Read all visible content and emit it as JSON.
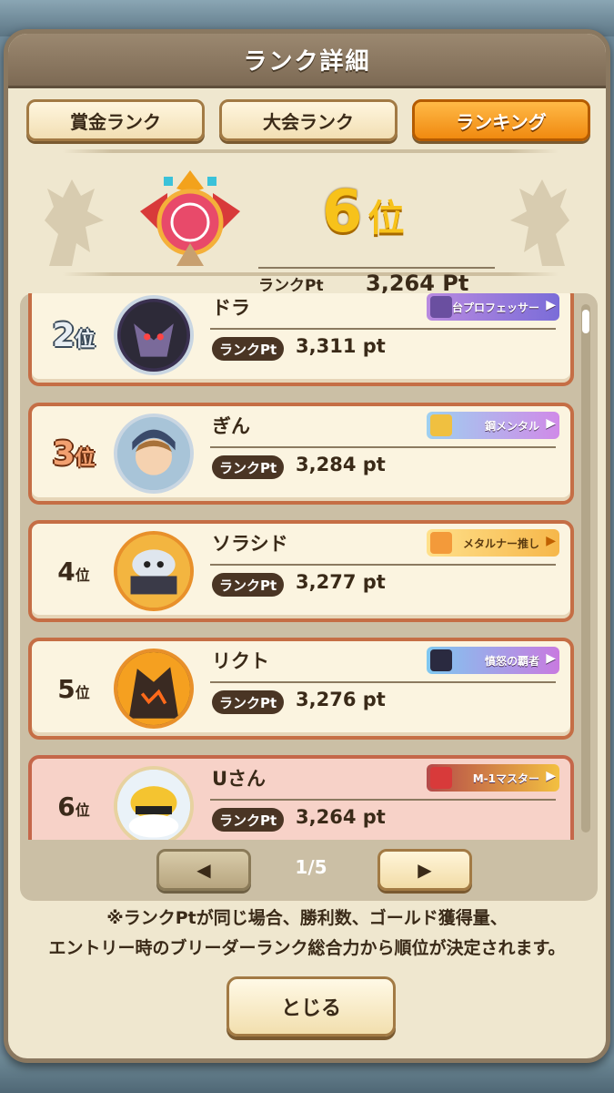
{
  "dialog": {
    "title": "ランク詳細"
  },
  "tabs": [
    {
      "label": "賞金ランク",
      "active": false
    },
    {
      "label": "大会ランク",
      "active": false
    },
    {
      "label": "ランキング",
      "active": true
    }
  ],
  "my_rank": {
    "position": "6",
    "position_suffix": "位",
    "pt_label": "ランクPt",
    "pt_value": "3,264 Pt"
  },
  "ranking_rows": [
    {
      "rank": "2",
      "rank_suffix": "位",
      "name": "ドラ",
      "title": "舞台プロフェッサー",
      "pt_label": "ランクPt",
      "pt": "3,311 pt",
      "self": false
    },
    {
      "rank": "3",
      "rank_suffix": "位",
      "name": "ぎん",
      "title": "鋼メンタル",
      "pt_label": "ランクPt",
      "pt": "3,284 pt",
      "self": false
    },
    {
      "rank": "4",
      "rank_suffix": "位",
      "name": "ソラシド",
      "title": "メタルナー推し",
      "pt_label": "ランクPt",
      "pt": "3,277 pt",
      "self": false
    },
    {
      "rank": "5",
      "rank_suffix": "位",
      "name": "リクト",
      "title": "憤怒の覇者",
      "pt_label": "ランクPt",
      "pt": "3,276 pt",
      "self": false
    },
    {
      "rank": "6",
      "rank_suffix": "位",
      "name": "Uさん",
      "title": "M-1マスター",
      "pt_label": "ランクPt",
      "pt": "3,264 pt",
      "self": true
    }
  ],
  "pagination": {
    "indicator": "1/5",
    "prev_icon": "triangle-left-icon",
    "next_icon": "triangle-right-icon"
  },
  "note": {
    "line1": "※ランクPtが同じ場合、勝利数、ゴールド獲得量、",
    "line2": "エントリー時のブリーダーランク総合力から順位が決定されます。"
  },
  "close_button": {
    "label": "とじる"
  },
  "colors": {
    "active_tab": "#f08a10",
    "row_border": "#c56e45",
    "self_row": "#f7d2c8",
    "gold": "#f7c21a"
  }
}
